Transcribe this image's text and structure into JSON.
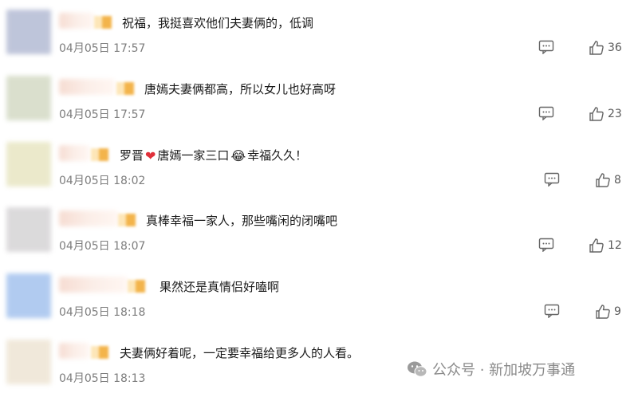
{
  "comments": [
    {
      "text": "祝福，我挺喜欢他们夫妻俩的，低调",
      "time": "04月05日 17:57",
      "likes": "36",
      "avatar_color": "#b8bfd6"
    },
    {
      "text": "唐嫣夫妻俩都高，所以女儿也好高呀",
      "time": "04月05日 17:57",
      "likes": "23",
      "avatar_color": "#d6dcc8"
    },
    {
      "text_a": "罗晋",
      "text_b": "唐嫣一家三口",
      "text_c": "幸福久久！",
      "heart_icon": "❤",
      "laugh_icon": "😂",
      "time": "04月05日 18:02",
      "likes": "8",
      "avatar_color": "#e9e7c6"
    },
    {
      "text": "真棒幸福一家人，那些嘴闲的闭嘴吧",
      "time": "04月05日 18:07",
      "likes": "12",
      "avatar_color": "#d8d6d8"
    },
    {
      "text": "果然还是真情侣好嗑啊",
      "time": "04月05日 18:18",
      "likes": "9",
      "avatar_color": "#a9c6ef"
    },
    {
      "text": "夫妻俩好着呢，一定要幸福给更多人的人看。",
      "time": "04月05日 18:13",
      "likes": "",
      "avatar_color": "#efe6d6"
    }
  ],
  "watermark": {
    "text": "公众号 · 新加坡万事通"
  }
}
